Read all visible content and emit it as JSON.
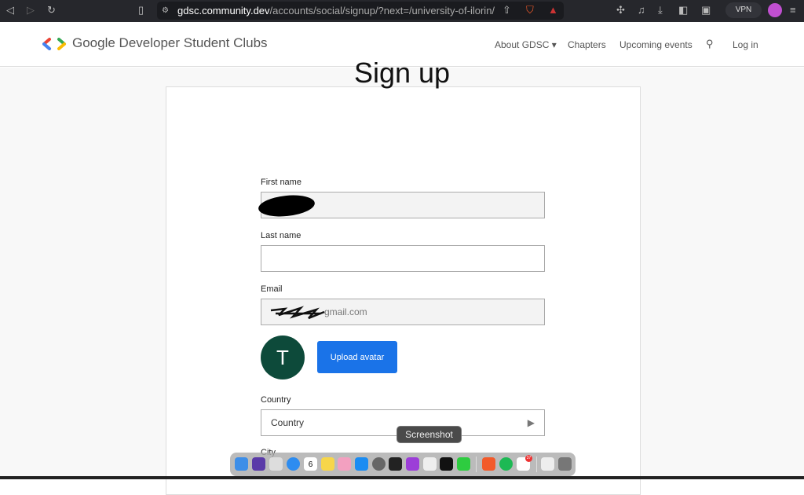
{
  "browser": {
    "url_host": "gdsc.community.dev",
    "url_path": "/accounts/social/signup/?next=/university-of-ilorin/",
    "vpn_label": "VPN",
    "brave_badge": "6"
  },
  "header": {
    "logo_text": "Google Developer Student Clubs",
    "nav": [
      "About GDSC",
      "Chapters",
      "Upcoming events",
      "Log in"
    ]
  },
  "form": {
    "title": "Sign up",
    "first_name_label": "First name",
    "last_name_label": "Last name",
    "last_name_value": "",
    "email_label": "Email",
    "email_value": "gmail.com",
    "avatar_letter": "T",
    "upload_label": "Upload avatar",
    "country_label": "Country",
    "country_value": "Country",
    "city_label": "City"
  },
  "dock": {
    "tooltip": "Screenshot",
    "apps": [
      "Finder",
      "Siri",
      "Launchpad",
      "Safari",
      "Calendar",
      "Notes",
      "Photos",
      "App Store",
      "System Preferences",
      "Terminal",
      "Podcasts",
      "Screenshot",
      "Apple TV",
      "WhatsApp",
      "Brave",
      "Spotify",
      "Slack",
      "Downloads",
      "Trash"
    ],
    "calendar_day": "6",
    "slack_badge": "37"
  },
  "colors": {
    "accent": "#1a73e8",
    "avatar": "#0d4a3a"
  }
}
